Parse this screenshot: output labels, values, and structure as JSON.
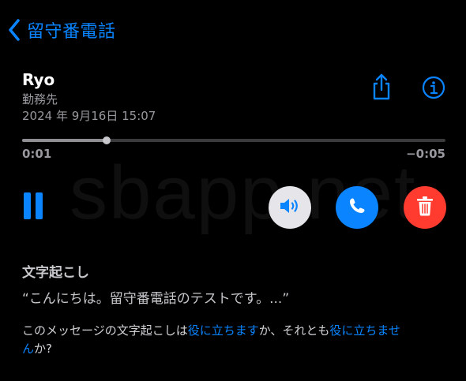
{
  "nav": {
    "back_label": "留守番電話"
  },
  "header": {
    "caller_name": "Ryo",
    "caller_label": "勤務先",
    "date": "2024 年 9月16日 15:07"
  },
  "playback": {
    "elapsed": "0:01",
    "remaining": "−0:05",
    "progress_fraction": 0.2
  },
  "watermark": {
    "text": "sbapp.net"
  },
  "transcript": {
    "title": "文字起こし",
    "text": "“こんにちは。留守番電話のテストです。...”"
  },
  "feedback": {
    "prefix": "このメッセージの文字起こしは",
    "useful_link": "役に立ちます",
    "middle": "か、それとも",
    "not_useful_link": "役に立ちません",
    "suffix": "か?"
  },
  "icons": {
    "back": "chevron-left-icon",
    "share": "share-icon",
    "info": "info-icon",
    "pause": "pause-icon",
    "speaker": "speaker-icon",
    "call": "phone-icon",
    "delete": "trash-icon"
  },
  "colors": {
    "accent": "#0a84ff",
    "delete": "#ff3b30",
    "speaker_bg": "#e5e5ea",
    "background": "#000000"
  }
}
